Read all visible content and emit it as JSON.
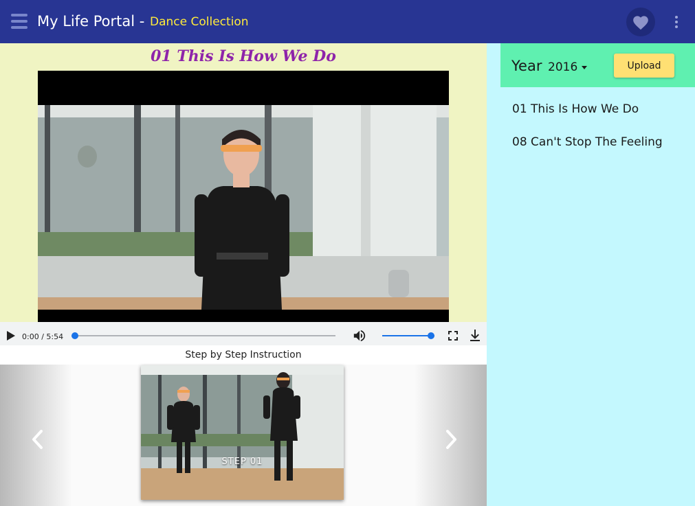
{
  "header": {
    "app_title": "My Life Portal -",
    "subtitle": "Dance Collection",
    "menu_icon": "menu-icon",
    "favorite_icon": "heart-icon",
    "more_icon": "more-vert-icon",
    "colors": {
      "bar": "#283593",
      "subtitle": "#ffeb3b"
    }
  },
  "player": {
    "title": "01 This Is How We Do",
    "time": "0:00 / 5:54",
    "progress": 0,
    "volume": 1.0,
    "icons": [
      "play-icon",
      "volume-icon",
      "fullscreen-icon",
      "download-icon"
    ]
  },
  "steps": {
    "heading": "Step by Step Instruction",
    "current_caption": "STEP 01",
    "prev_icon": "chevron-left-icon",
    "next_icon": "chevron-right-icon"
  },
  "sidebar": {
    "year_label": "Year",
    "year_value": "2016",
    "upload_label": "Upload",
    "items": [
      {
        "label": "01 This Is How We Do"
      },
      {
        "label": "08 Can't Stop The Feeling"
      }
    ],
    "colors": {
      "panel": "#c4f8fe",
      "year_bar": "#5ff0b0",
      "upload": "#ffe073"
    }
  }
}
